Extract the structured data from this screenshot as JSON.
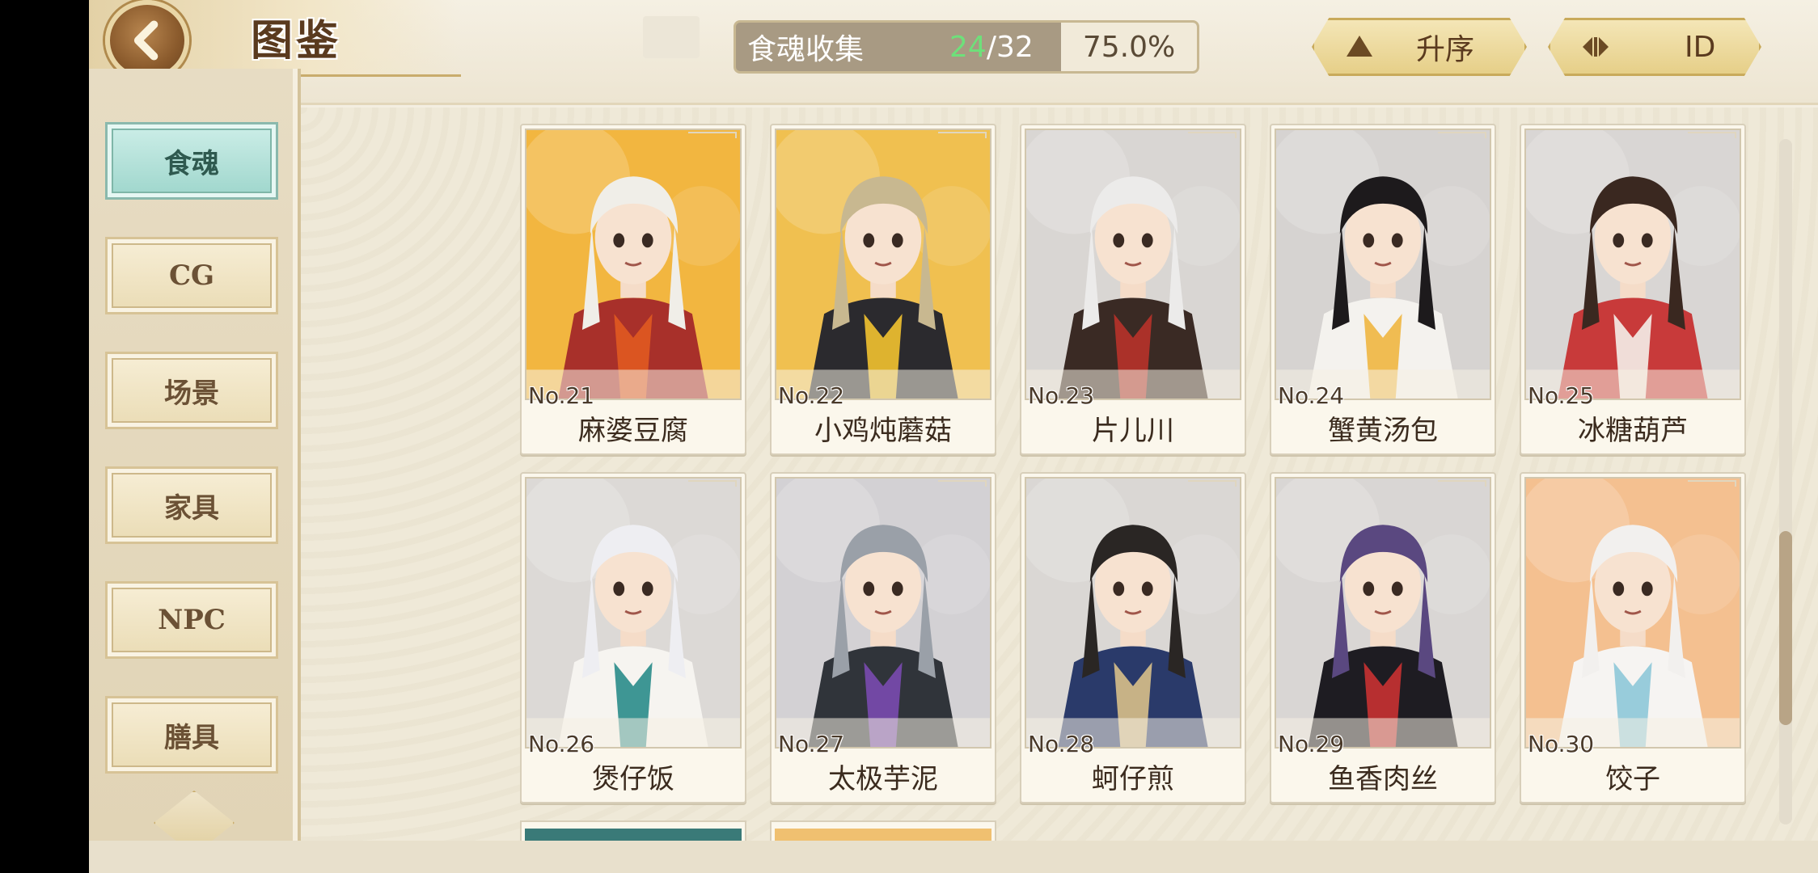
{
  "header": {
    "title": "图鉴",
    "collection": {
      "label": "食魂收集",
      "collected": "24",
      "total": "/32",
      "percent": "75.0%"
    },
    "sort_order_label": "升序",
    "sort_key_label": "ID"
  },
  "sidebar": {
    "items": [
      {
        "label": "食魂",
        "active": true
      },
      {
        "label": "CG"
      },
      {
        "label": "场景"
      },
      {
        "label": "家具"
      },
      {
        "label": "NPC"
      },
      {
        "label": "膳具"
      }
    ]
  },
  "cards": [
    {
      "no": "No.21",
      "name": "麻婆豆腐",
      "bg": "#f2b640",
      "hair": "#f0eee8",
      "outfit": "#a8302a",
      "accent": "#e05a20"
    },
    {
      "no": "No.22",
      "name": "小鸡炖蘑菇",
      "bg": "#f0c050",
      "hair": "#c8b890",
      "outfit": "#2b2a2e",
      "accent": "#f2c230"
    },
    {
      "no": "No.23",
      "name": "片儿川",
      "bg": "#d9d6d3",
      "hair": "#ecebea",
      "outfit": "#3a2a24",
      "accent": "#b8322a"
    },
    {
      "no": "No.24",
      "name": "蟹黄汤包",
      "bg": "#d6d3d1",
      "hair": "#1d1a1c",
      "outfit": "#f4f2ee",
      "accent": "#f0b640"
    },
    {
      "no": "No.25",
      "name": "冰糖葫芦",
      "bg": "#d9d6d4",
      "hair": "#3a2820",
      "outfit": "#c83a3a",
      "accent": "#f4f0ea"
    },
    {
      "no": "No.26",
      "name": "煲仔饭",
      "bg": "#dcd9d6",
      "hair": "#eeeef2",
      "outfit": "#f6f4f0",
      "accent": "#2a8c8a"
    },
    {
      "no": "No.27",
      "name": "太极芋泥",
      "bg": "#d3d1d4",
      "hair": "#9aa0a8",
      "outfit": "#30343a",
      "accent": "#7a4ab0"
    },
    {
      "no": "No.28",
      "name": "蚵仔煎",
      "bg": "#dad7d4",
      "hair": "#2a2624",
      "outfit": "#2a3a6a",
      "accent": "#d8c08a"
    },
    {
      "no": "No.29",
      "name": "鱼香肉丝",
      "bg": "#d9d6d4",
      "hair": "#5a4880",
      "outfit": "#1e1c22",
      "accent": "#c83232"
    },
    {
      "no": "No.30",
      "name": "饺子",
      "bg": "#f4c090",
      "hair": "#f2f0ee",
      "outfit": "#f6f4f2",
      "accent": "#8ec8d8"
    }
  ],
  "partial_cards": [
    {
      "bg": "#3a7a78"
    },
    {
      "bg": "#f0c070"
    }
  ],
  "colors": {
    "accent_green": "#6ee07a",
    "active_tab": "#9ed6cc",
    "gold_button": "#e6cf88"
  }
}
